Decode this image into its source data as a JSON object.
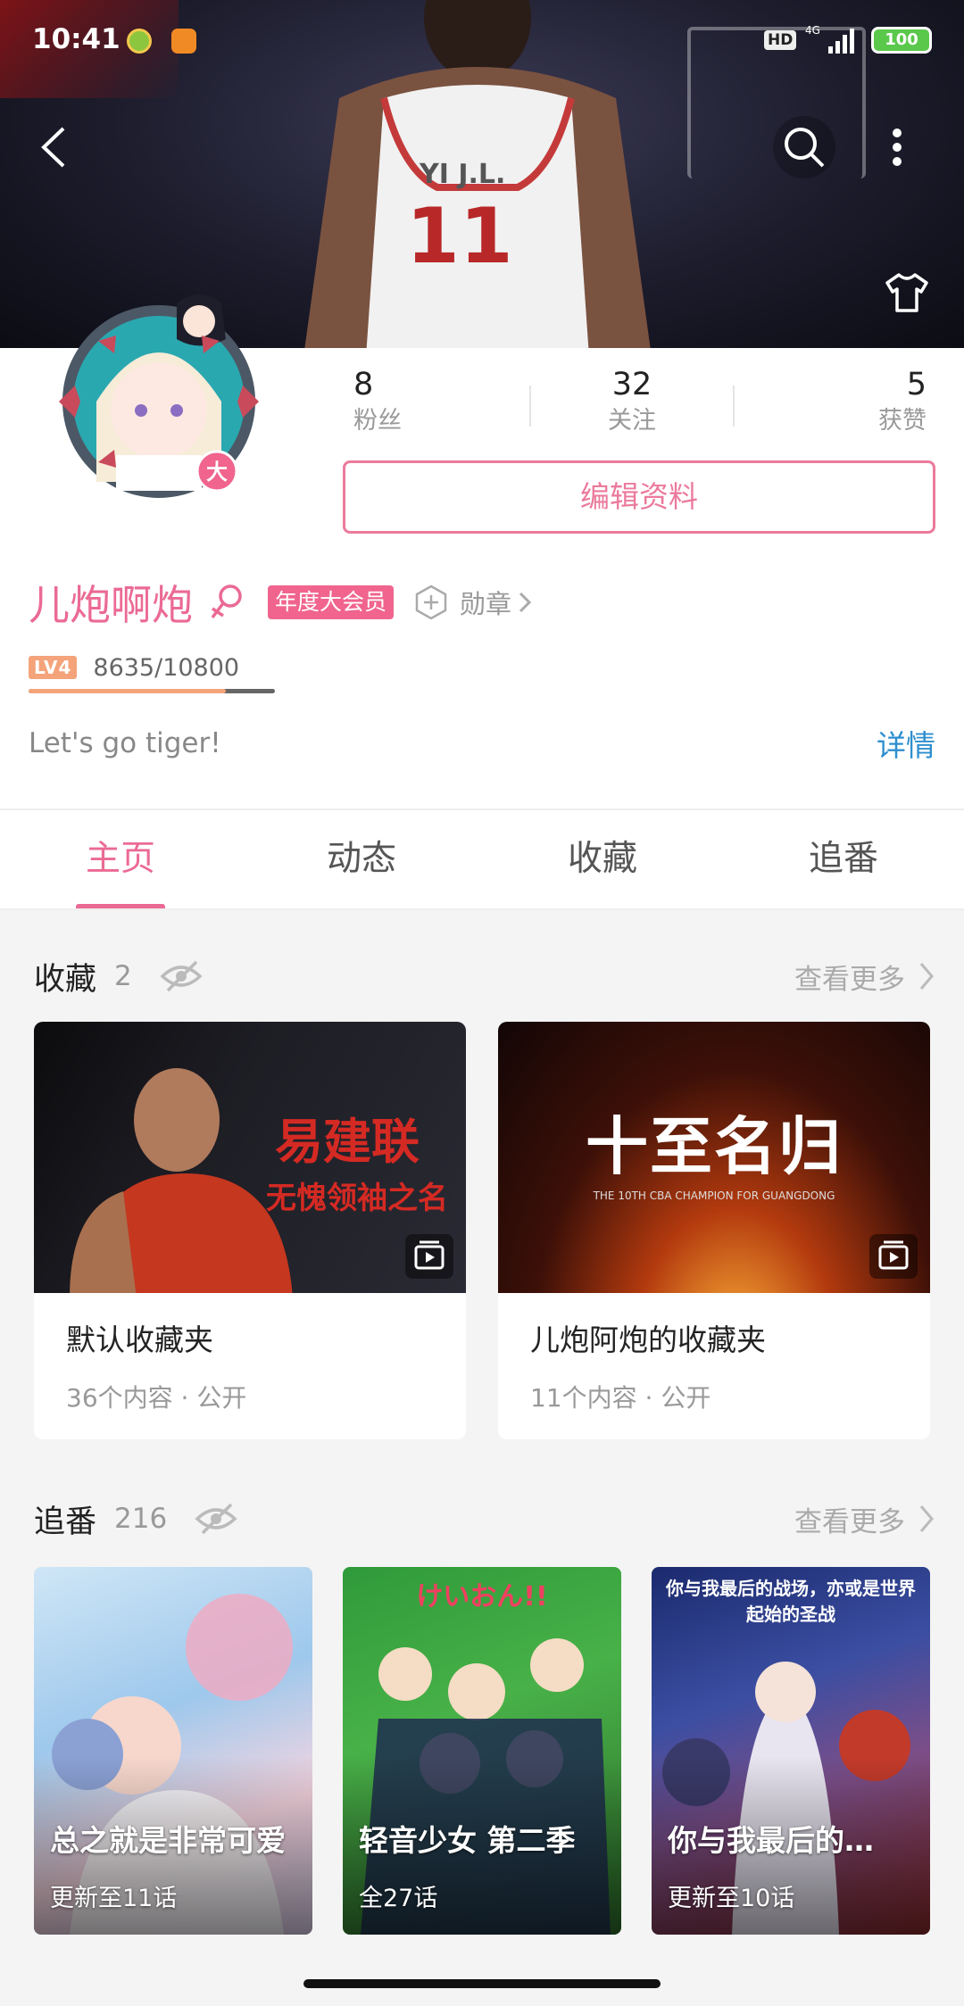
{
  "status_bar": {
    "time": "10:41",
    "hd": "HD",
    "network": "4G",
    "battery": "100"
  },
  "banner": {
    "jersey_text": "YI J.L.",
    "jersey_number": "11"
  },
  "profile": {
    "avatar_badge": "大",
    "stats": [
      {
        "value": "8",
        "label": "粉丝"
      },
      {
        "value": "32",
        "label": "关注"
      },
      {
        "value": "5",
        "label": "获赞"
      }
    ],
    "edit_button": "编辑资料",
    "username": "儿炮啊炮",
    "gender": "female",
    "vip_badge": "年度大会员",
    "medal_label": "勋章",
    "level_badge": "LV4",
    "level_progress_text": "8635/10800",
    "level_progress_fraction": 0.8,
    "signature": "Let's go tiger!",
    "detail_link": "详情"
  },
  "tabs": [
    {
      "label": "主页",
      "active": true
    },
    {
      "label": "动态",
      "active": false
    },
    {
      "label": "收藏",
      "active": false
    },
    {
      "label": "追番",
      "active": false
    }
  ],
  "favorites": {
    "title": "收藏",
    "count": "2",
    "more": "查看更多",
    "items": [
      {
        "name": "默认收藏夹",
        "meta": "36个内容 · 公开",
        "cover_text_main": "易建联",
        "cover_text_sub": "无愧领袖之名"
      },
      {
        "name": "儿炮阿炮的收藏夹",
        "meta": "11个内容 · 公开",
        "cover_text_main": "十至名归",
        "cover_text_sub": "THE 10TH CBA CHAMPION FOR GUANGDONG"
      }
    ]
  },
  "bangumi": {
    "title": "追番",
    "count": "216",
    "more": "查看更多",
    "items": [
      {
        "title": "总之就是非常可爱",
        "episodes": "更新至11话"
      },
      {
        "title": "轻音少女 第二季",
        "episodes": "全27话",
        "cover_logo": "けいおん!!"
      },
      {
        "title": "你与我最后的…",
        "episodes": "更新至10话",
        "cover_logo": "你与我最后的战场，亦或是世界起始的圣战"
      }
    ]
  },
  "colors": {
    "accent": "#eb6a94",
    "link": "#2e8fcf",
    "vip": "#f0648e"
  }
}
